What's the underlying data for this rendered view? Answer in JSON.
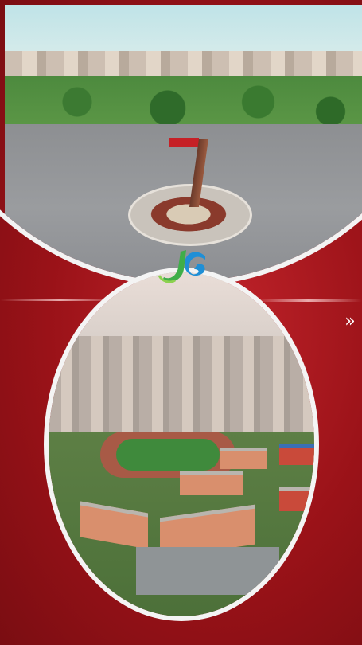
{
  "colors": {
    "background_red": "#9a1218",
    "frame_white": "#f3f3f3",
    "logo_green": "#3fae49",
    "logo_blue": "#1f8fd6"
  },
  "icons": {
    "logo": "jg-logo-icon",
    "next": "double-chevron-right-icon"
  },
  "next_button": {
    "glyph": "»"
  }
}
